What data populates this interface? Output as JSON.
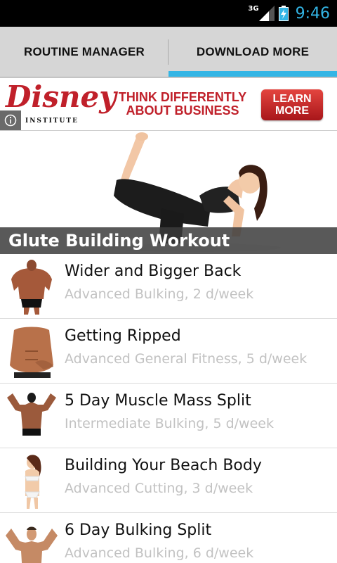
{
  "status_bar": {
    "network": "3G",
    "time": "9:46",
    "clock_color": "#33b5e5",
    "icons": [
      "signal-icon",
      "battery-charging-icon"
    ]
  },
  "tabs": [
    {
      "label": "ROUTINE MANAGER",
      "selected": false
    },
    {
      "label": "DOWNLOAD MORE",
      "selected": true
    }
  ],
  "accent_color": "#33b5e5",
  "ad": {
    "brand": "Disney",
    "brand_sub": "INSTITUTE",
    "tagline_line1": "THINK DIFFERENTLY",
    "tagline_line2": "ABOUT BUSINESS",
    "cta_line1": "LEARN",
    "cta_line2": "MORE",
    "brand_color": "#c0202a",
    "info_icon": "info-icon"
  },
  "featured": {
    "title": "Glute Building Workout"
  },
  "routines": [
    {
      "title": "Wider and Bigger Back",
      "subtitle": "Advanced Bulking, 2 d/week",
      "thumb": "back-muscles-thumbnail"
    },
    {
      "title": "Getting Ripped",
      "subtitle": "Advanced General Fitness, 5 d/week",
      "thumb": "torso-thumbnail"
    },
    {
      "title": "5 Day Muscle Mass Split",
      "subtitle": "Intermediate Bulking, 5 d/week",
      "thumb": "flexing-back-thumbnail"
    },
    {
      "title": "Building Your Beach Body",
      "subtitle": "Advanced Cutting, 3 d/week",
      "thumb": "bikini-thumbnail"
    },
    {
      "title": "6 Day Bulking Split",
      "subtitle": "Advanced Bulking, 6 d/week",
      "thumb": "flexing-front-thumbnail"
    }
  ]
}
